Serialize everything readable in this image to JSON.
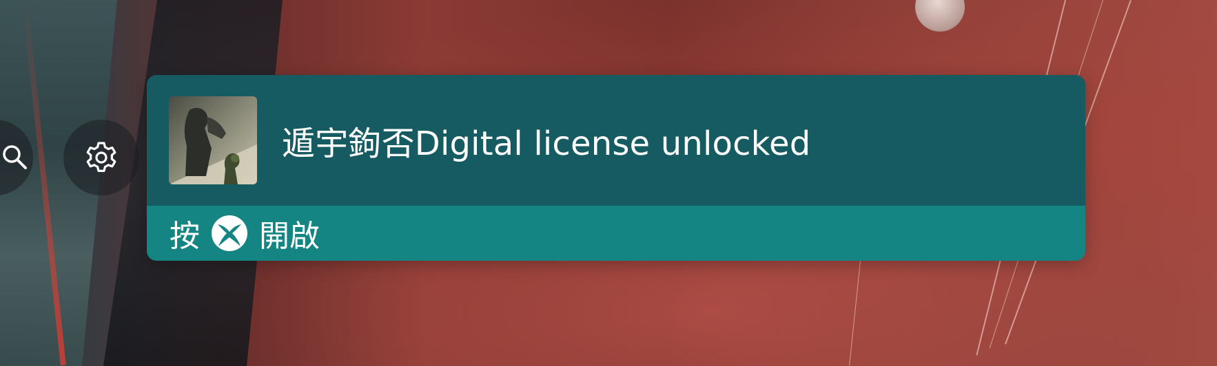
{
  "notification": {
    "title": "遁宇鉤否Digital license unlocked",
    "action_prefix": "按",
    "action_suffix": "開啟",
    "button_icon": "xbox-button-icon",
    "game_thumbnail": "game-thumbnail"
  },
  "shortcuts": {
    "search_icon": "search-icon",
    "settings_icon": "gear-icon"
  },
  "colors": {
    "toast_main": "#175b62",
    "toast_action": "#158583",
    "text": "#ffffff"
  }
}
